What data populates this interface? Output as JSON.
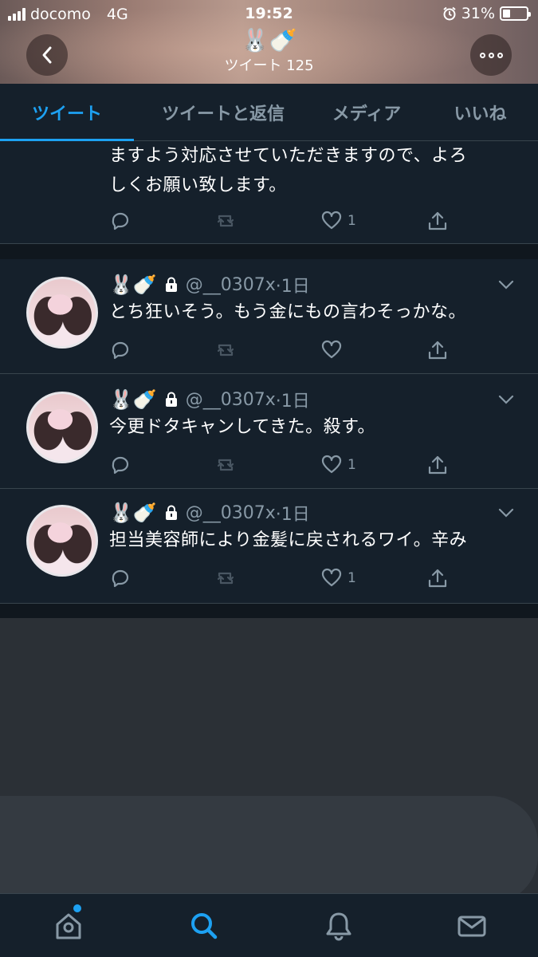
{
  "status_bar": {
    "carrier": "docomo",
    "network": "4G",
    "time": "19:52",
    "battery_percent": "31%",
    "battery_level": 0.31
  },
  "header": {
    "title_emoji": "🐰🍼",
    "tweet_count_label": "ツイート 125"
  },
  "tabs": [
    {
      "label": "ツイート",
      "active": true
    },
    {
      "label": "ツイートと返信",
      "active": false
    },
    {
      "label": "メディア",
      "active": false
    },
    {
      "label": "いいね",
      "active": false
    }
  ],
  "partial_tweet": {
    "text_line1": "ますよう対応させていただきますので、よろ",
    "text_line2": "しくお願い致します。",
    "like_count": "1"
  },
  "tweets": [
    {
      "name_emoji": "🐰🍼",
      "handle": "@__0307x",
      "time": "·1日",
      "text": "とち狂いそう。もう金にもの言わそっかな。",
      "like_count": ""
    },
    {
      "name_emoji": "🐰🍼",
      "handle": "@__0307x",
      "time": "·1日",
      "text": "今更ドタキャンしてきた。殺す。",
      "like_count": "1"
    },
    {
      "name_emoji": "🐰🍼",
      "handle": "@__0307x",
      "time": "·1日",
      "text": "担当美容師により金髪に戻されるワイ。辛み",
      "like_count": "1"
    }
  ],
  "colors": {
    "accent": "#1da1f2",
    "background": "#15202b",
    "muted": "#8899a6"
  },
  "bottom_nav": [
    "home-icon",
    "search-icon",
    "bell-icon",
    "mail-icon"
  ]
}
